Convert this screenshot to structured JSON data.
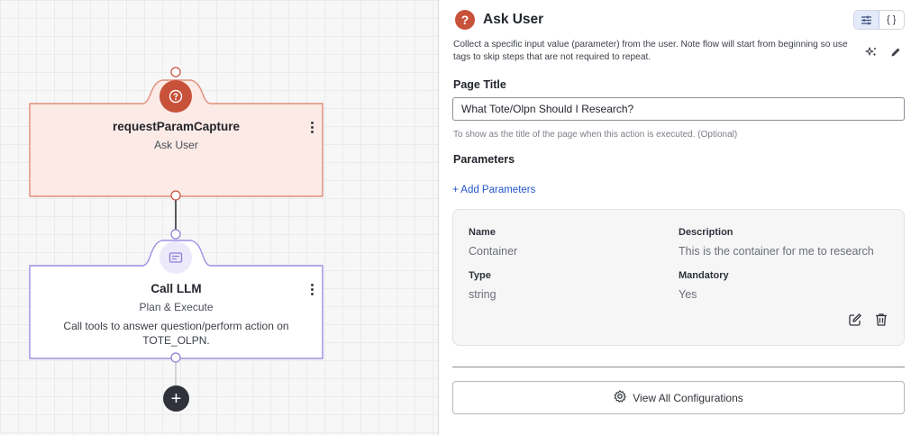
{
  "canvas": {
    "nodes": [
      {
        "title": "requestParamCapture",
        "subtitle": "Ask User",
        "icon": "question-circle-icon",
        "accent": "#c8513a"
      },
      {
        "title": "Call LLM",
        "subtitle": "Plan & Execute",
        "description": "Call tools to answer question/perform action on TOTE_OLPN.",
        "icon": "card-icon",
        "accent": "#8c7fd8"
      }
    ],
    "add_button_label": "+"
  },
  "panel": {
    "header": {
      "icon_label": "?",
      "title": "Ask User",
      "description": "Collect a specific input value (parameter) from the user. Note flow will start from beginning so use tags to skip steps that are not required to repeat.",
      "toggle": {
        "settings_icon": "sliders-icon",
        "code_label": "{ }"
      }
    },
    "page_title": {
      "label": "Page Title",
      "value": "What Tote/Olpn Should I Research?",
      "hint": "To show as the title of the page when this action is executed. (Optional)"
    },
    "parameters": {
      "label": "Parameters",
      "add_label": "+ Add Parameters",
      "items": [
        {
          "name_label": "Name",
          "name": "Container",
          "description_label": "Description",
          "description": "This is the container for me to research",
          "type_label": "Type",
          "type": "string",
          "mandatory_label": "Mandatory",
          "mandatory": "Yes"
        }
      ]
    },
    "view_all_label": "View All Configurations"
  },
  "colors": {
    "ask_user_accent": "#c8513a",
    "ask_user_fill": "#fbeae6",
    "llm_accent": "#8c7fd8",
    "link": "#2456c9"
  }
}
